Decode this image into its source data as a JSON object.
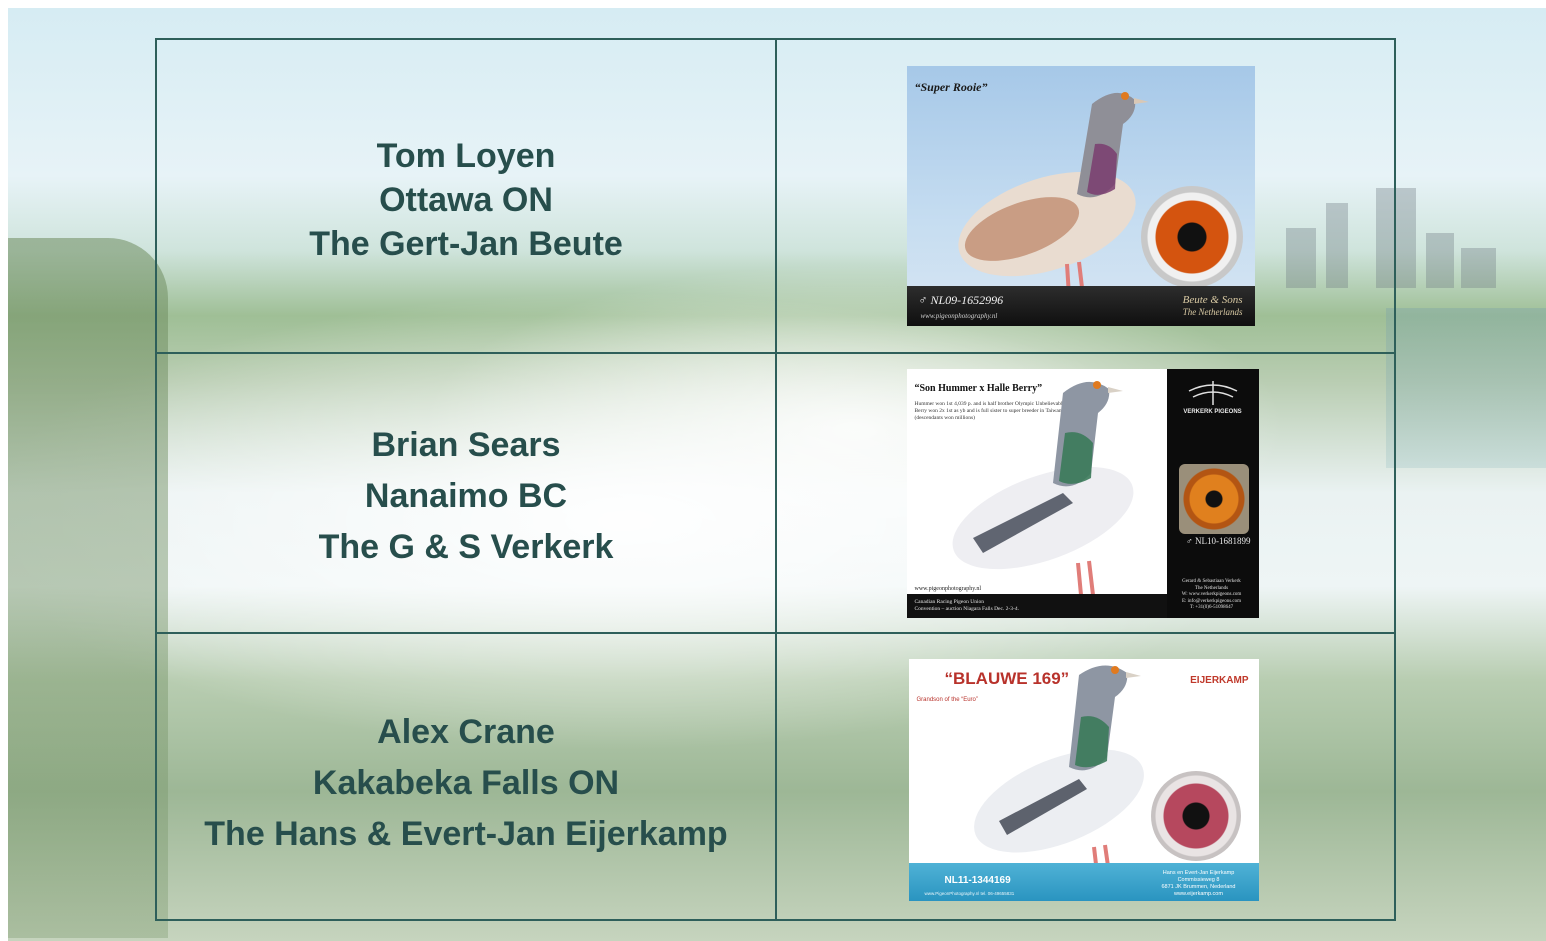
{
  "entries": [
    {
      "name": "Tom Loyen",
      "location": "Ottawa ON",
      "bird_from": "The Gert-Jan Beute",
      "photo": {
        "title": "“Super Rooie”",
        "ring": "♂ NL09-1652996",
        "website": "www.pigeonphotography.nl",
        "brand": "Beute & Sons",
        "country": "The Netherlands"
      }
    },
    {
      "name": "Brian Sears",
      "location": "Nanaimo BC",
      "bird_from": "The G & S Verkerk",
      "photo": {
        "title": "“Son Hummer x Halle Berry”",
        "description": "Hummer won 1st 4,039 p. and is half brother Olympic Unbelievable. Halle Berry won 2x 1st as yb and is full sister to super breeder in Taiwan (descendants won millions)",
        "brand": "VERKERK PIGEONS",
        "ring": "♂ NL10-1681899",
        "website": "www.pigeonphotography.nl",
        "union": "Canadian Racing Pigeon Union\nConvention – auction Niagara Falls Dec. 2-3-4.",
        "contact": "Gerard & Sebastiaan Verkerk\nThe Netherlands\nW: www.verkerkpigeons.com\nE: info@verkerkpigeons.com\nT: +31(0)6-51098647"
      }
    },
    {
      "name": "Alex Crane",
      "location": "Kakabeka Falls ON",
      "bird_from": "The Hans & Evert-Jan Eijerkamp",
      "photo": {
        "title": "“BLAUWE 169”",
        "subtitle": "Grandson of the “Euro”",
        "brand": "EIJERKAMP",
        "ring": "NL11-1344169",
        "website": "www.PigeonPhotography.nl   tel. 06-49655831",
        "contact": "Hans en Evert-Jan Eijerkamp\nCommissieweg 8\n6871 JK Brummen, Nederland\nwww.eijerkamp.com"
      }
    }
  ],
  "colors": {
    "text": "#274e4c",
    "border": "#2e5f5a"
  }
}
